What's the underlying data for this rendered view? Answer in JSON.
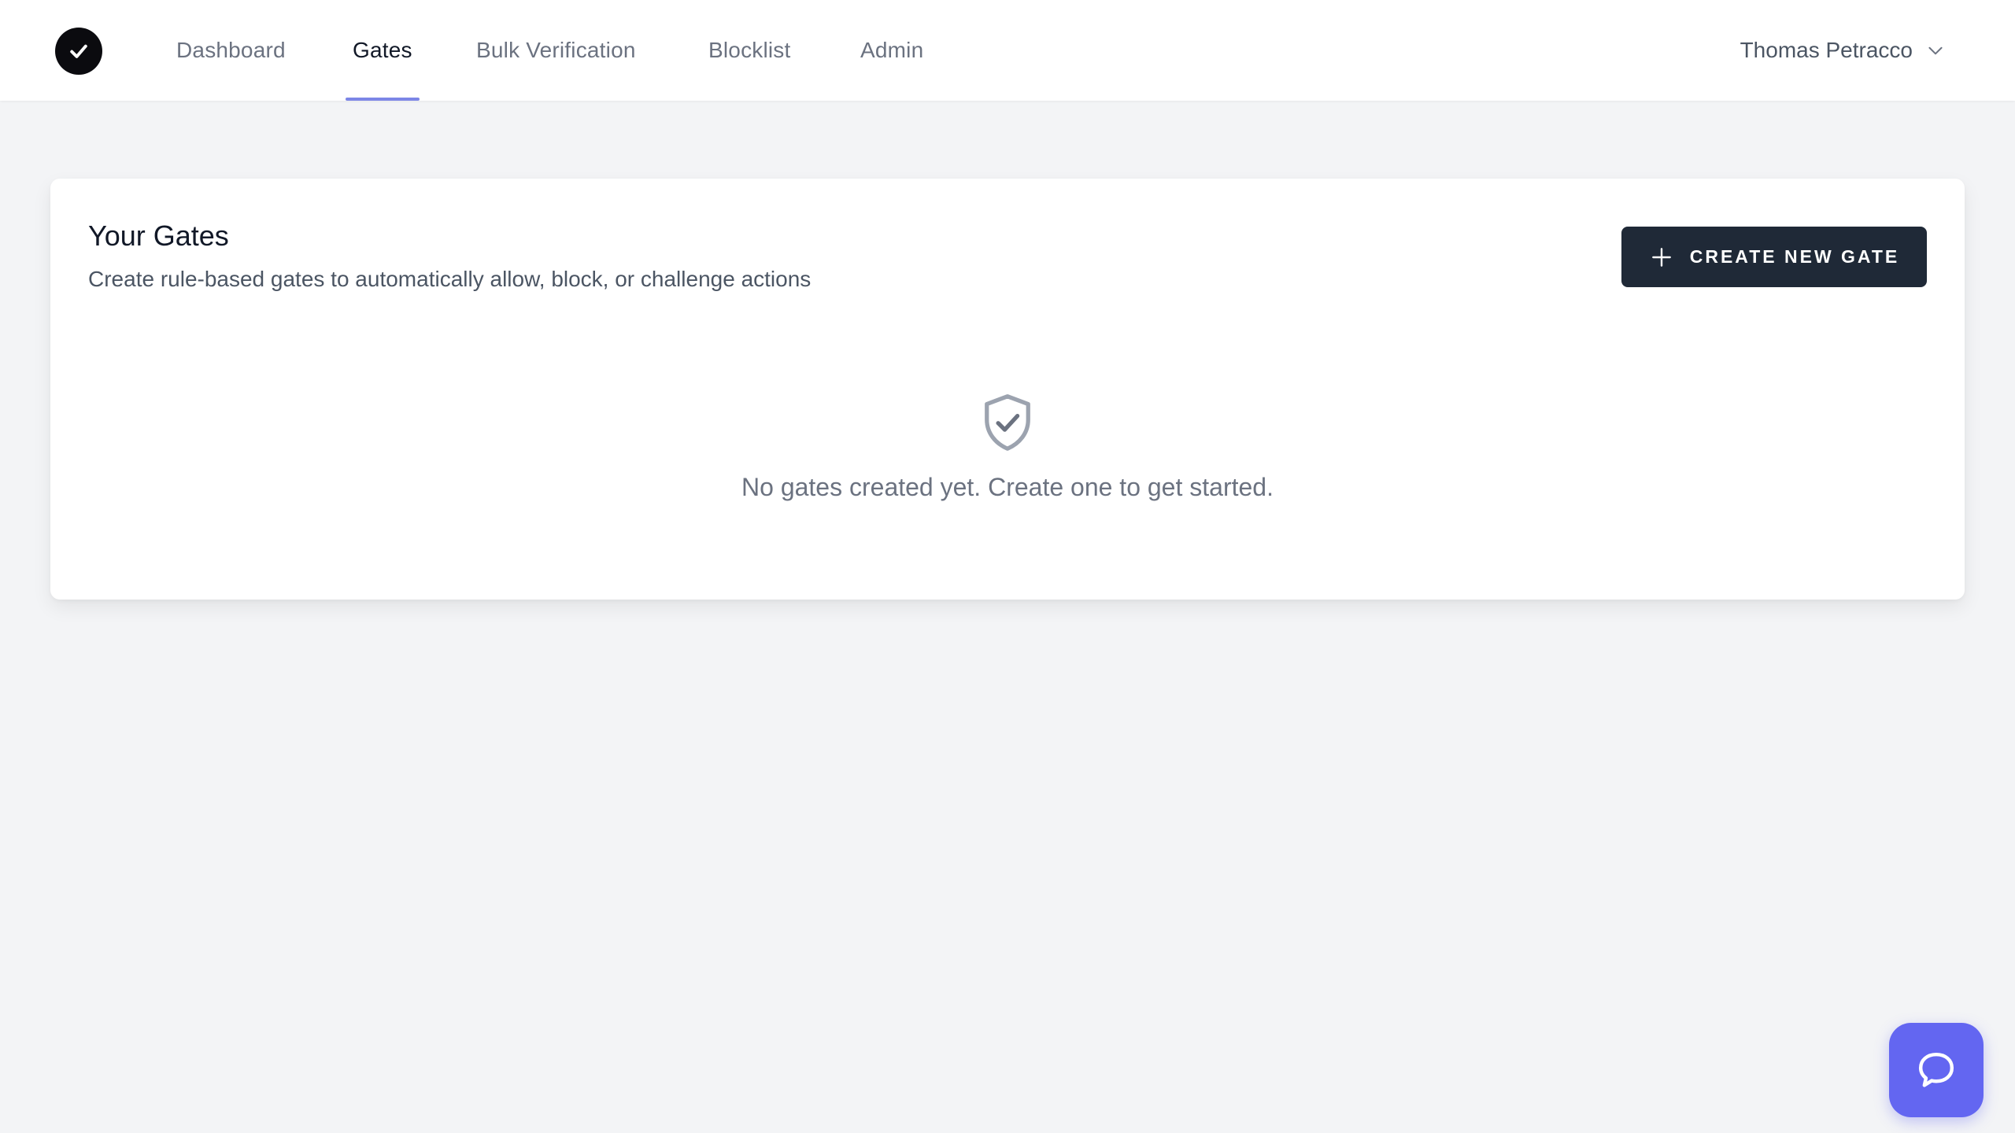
{
  "nav": {
    "logo_icon": "check-circle-icon",
    "items": [
      {
        "label": "Dashboard",
        "active": false
      },
      {
        "label": "Gates",
        "active": true
      },
      {
        "label": "Bulk Verification",
        "active": false
      },
      {
        "label": "Blocklist",
        "active": false
      },
      {
        "label": "Admin",
        "active": false
      }
    ],
    "user": {
      "name": "Thomas Petracco",
      "icon": "chevron-down-icon"
    }
  },
  "card": {
    "title": "Your Gates",
    "subtitle": "Create rule-based gates to automatically allow, block, or challenge actions",
    "create_button": {
      "label": "CREATE NEW GATE",
      "icon": "plus-icon"
    },
    "empty_state": {
      "icon": "shield-check-icon",
      "message": "No gates created yet. Create one to get started."
    }
  },
  "help": {
    "icon": "chat-bubble-icon"
  },
  "colors": {
    "accent": "#7c86e6",
    "button_bg": "#1f2937",
    "help_bg": "#6366f1",
    "page_bg": "#f3f4f6"
  }
}
